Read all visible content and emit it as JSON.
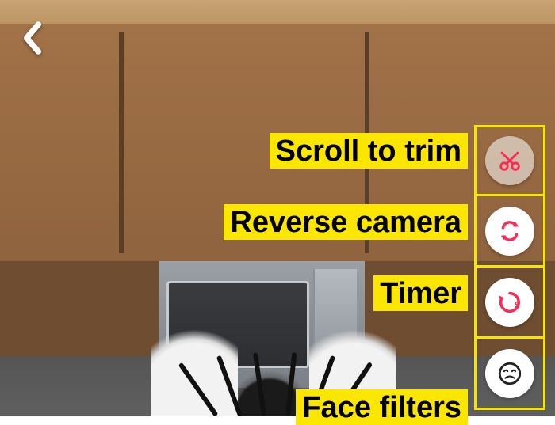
{
  "colors": {
    "highlight": "#fbe600",
    "accent": "#fb2b55"
  },
  "buttons": {
    "back": "Back"
  },
  "labels": {
    "trim": "Scroll to trim",
    "reverse": "Reverse camera",
    "timer": "Timer",
    "filters": "Face filters"
  },
  "tools": {
    "trim": {
      "icon": "scissors-icon",
      "label_key": "labels.trim"
    },
    "reverse": {
      "icon": "reverse-icon",
      "label_key": "labels.reverse"
    },
    "timer": {
      "icon": "timer-icon",
      "label_key": "labels.timer",
      "seconds": 5
    },
    "filters": {
      "icon": "face-icon",
      "label_key": "labels.filters"
    }
  }
}
